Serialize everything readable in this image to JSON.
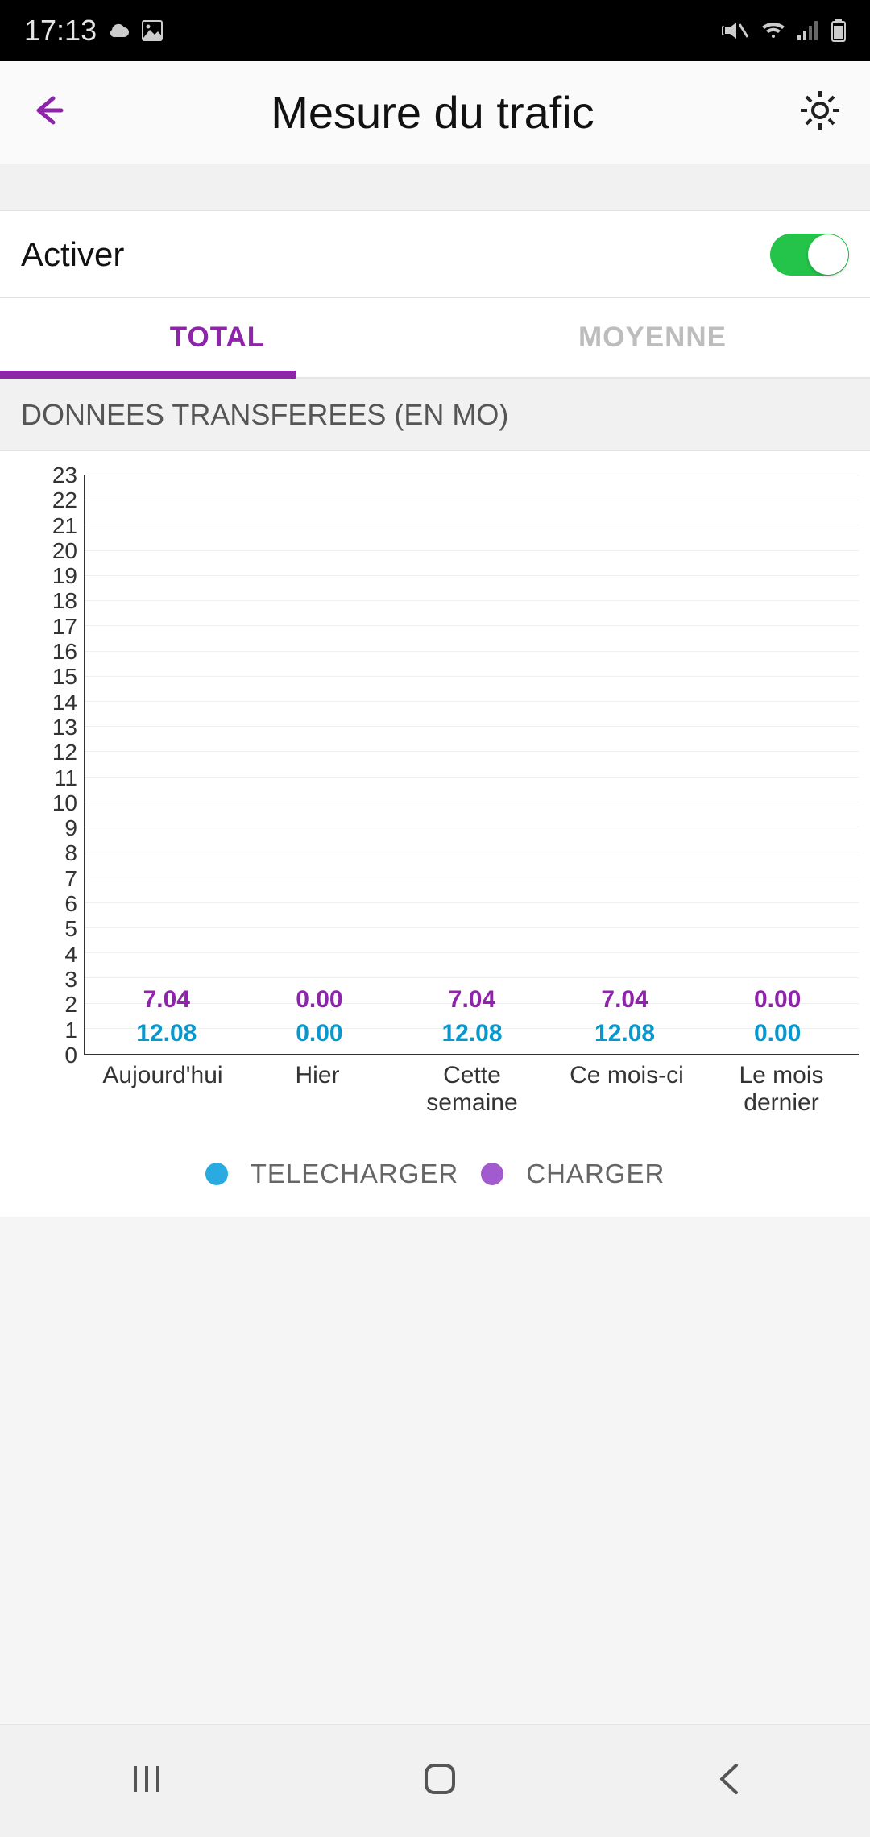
{
  "status": {
    "time": "17:13"
  },
  "header": {
    "title": "Mesure du trafic"
  },
  "activate": {
    "label": "Activer",
    "enabled": true
  },
  "tabs": {
    "total": "TOTAL",
    "average": "MOYENNE",
    "active": "total"
  },
  "section": {
    "label": "DONNEES TRANSFEREES (EN MO)"
  },
  "legend": {
    "download": "TELECHARGER",
    "upload": "CHARGER"
  },
  "colors": {
    "download": "#29abe2",
    "upload": "#a15bcf",
    "accent": "#8e24aa"
  },
  "chart_data": {
    "type": "bar",
    "title": "DONNEES TRANSFEREES (EN MO)",
    "xlabel": "",
    "ylabel": "",
    "ylim": [
      0,
      23
    ],
    "yticks": [
      0,
      1,
      2,
      3,
      4,
      5,
      6,
      7,
      8,
      9,
      10,
      11,
      12,
      13,
      14,
      15,
      16,
      17,
      18,
      19,
      20,
      21,
      22,
      23
    ],
    "categories": [
      "Aujourd'hui",
      "Hier",
      "Cette semaine",
      "Ce mois-ci",
      "Le mois dernier"
    ],
    "series": [
      {
        "name": "TELECHARGER",
        "values": [
          12.08,
          0.0,
          12.08,
          12.08,
          0.0
        ]
      },
      {
        "name": "CHARGER",
        "values": [
          7.04,
          0.0,
          7.04,
          7.04,
          0.0
        ]
      }
    ],
    "stacked": true
  }
}
